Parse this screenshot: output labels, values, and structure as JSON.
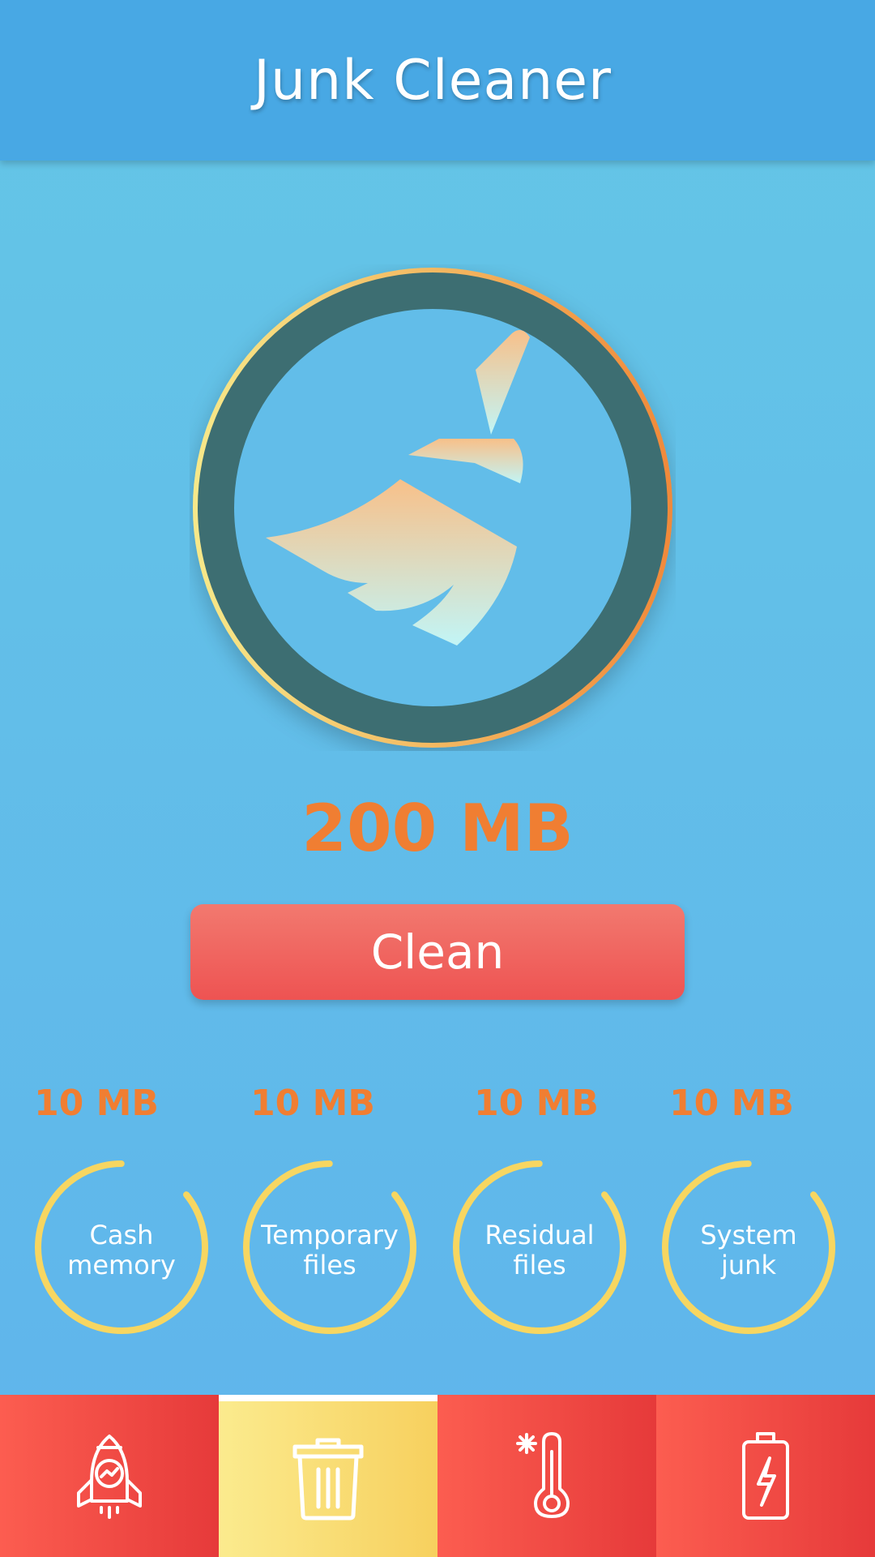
{
  "header": {
    "title": "Junk Cleaner"
  },
  "summary": {
    "total_size": "200 MB",
    "clean_label": "Clean"
  },
  "categories": [
    {
      "size": "10 MB",
      "label": "Cash\nmemory"
    },
    {
      "size": "10 MB",
      "label": "Temporary\nfiles"
    },
    {
      "size": "10 MB",
      "label": "Residual\nfiles"
    },
    {
      "size": "10 MB",
      "label": "System\njunk"
    }
  ],
  "nav": {
    "tabs": [
      {
        "icon": "rocket-icon",
        "active": false
      },
      {
        "icon": "trash-icon",
        "active": true
      },
      {
        "icon": "thermometer-snowflake-icon",
        "active": false
      },
      {
        "icon": "battery-charging-icon",
        "active": false
      }
    ]
  },
  "colors": {
    "header_bg": "#48a8e4",
    "accent_orange": "#f07e32",
    "clean_button": "#ee5352",
    "ring_yellow": "#f7d661",
    "nav_red": "#f24b45",
    "nav_active_yellow": "#f8dc72"
  }
}
